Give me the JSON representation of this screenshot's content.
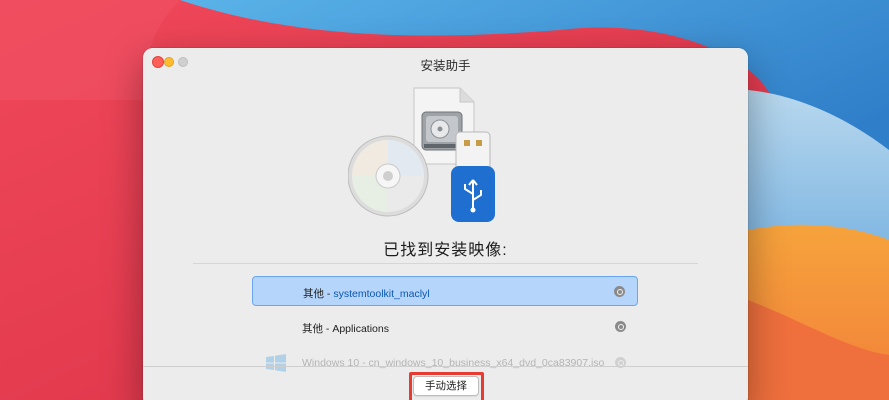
{
  "window": {
    "title": "安装助手"
  },
  "main": {
    "heading": "已找到安装映像:"
  },
  "images": [
    {
      "prefix": "其他",
      "sep": " - ",
      "name": "systemtoolkit_maclyl",
      "selected": true
    },
    {
      "prefix": "其他",
      "sep": " - ",
      "name": "Applications",
      "selected": false
    },
    {
      "prefix": "Windows 10",
      "sep": " - ",
      "name": "cn_windows_10_business_x64_dvd_0ca83907.iso",
      "selected": false
    }
  ],
  "footer": {
    "manual_select_label": "手动选择"
  },
  "icons": {
    "disc": "cd-disc-icon",
    "drive": "hard-drive-document-icon",
    "usb": "usb-drive-icon",
    "search": "magnifier-icon",
    "windows": "windows-logo-icon"
  },
  "colors": {
    "selection": "#b6d5fb",
    "selection_border": "#6aa6ef",
    "highlight": "#e53b32"
  }
}
